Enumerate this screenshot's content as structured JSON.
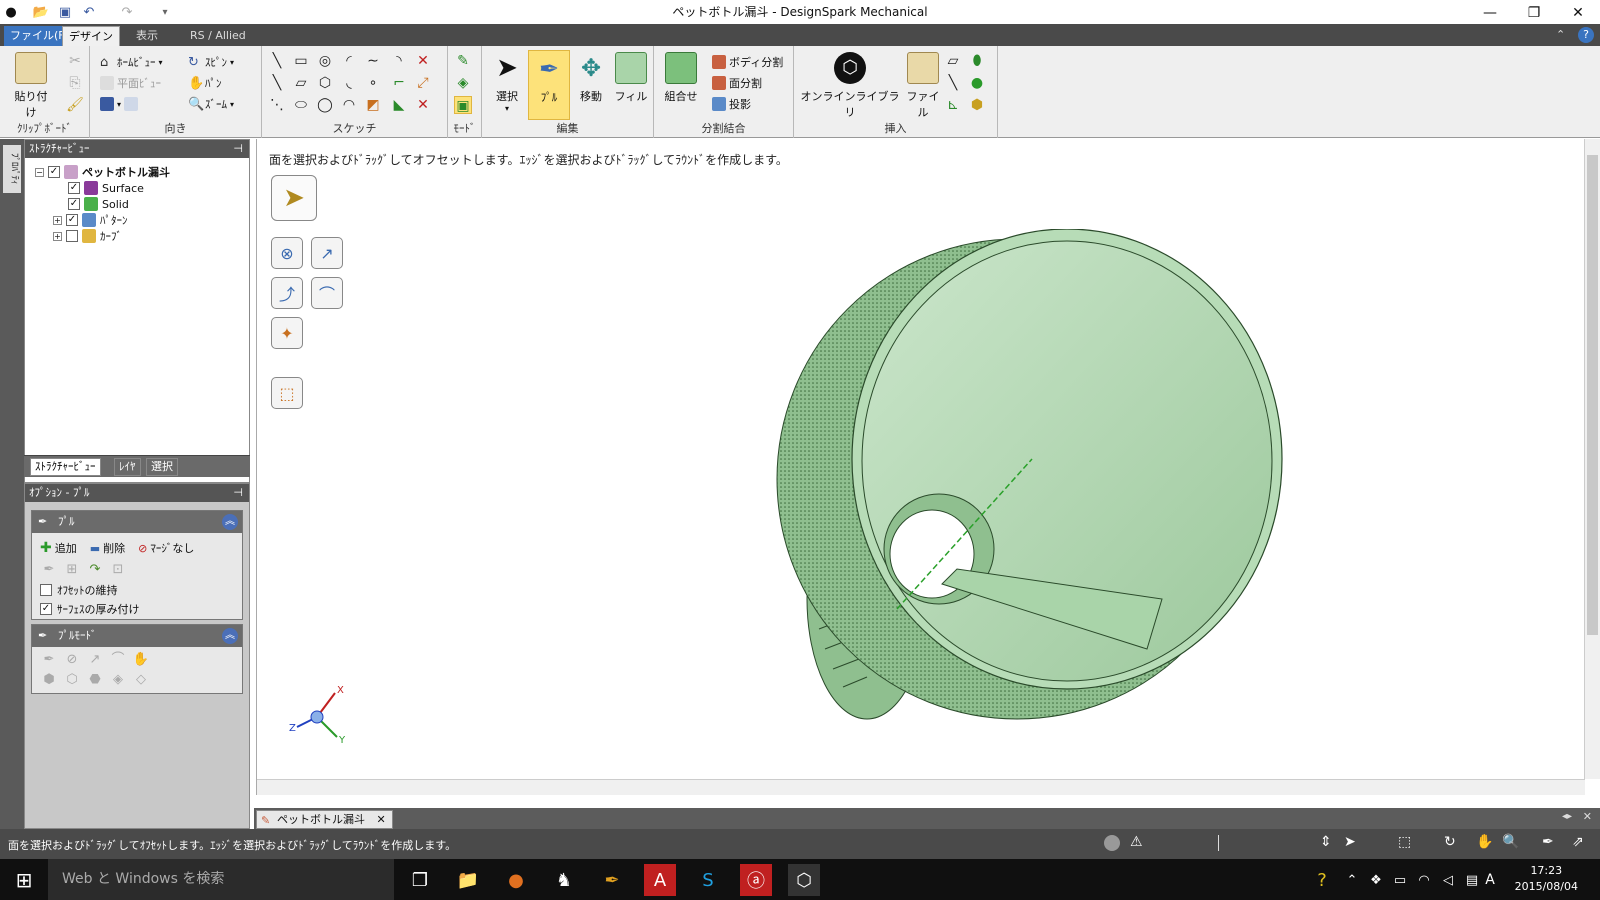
{
  "app": {
    "title": "ペットボトル漏斗 - DesignSpark Mechanical"
  },
  "window_controls": {
    "minimize": "—",
    "maximize": "❐",
    "close": "✕"
  },
  "tabs": [
    {
      "label": "ファイル(F)"
    },
    {
      "label": "デザイン"
    },
    {
      "label": "表示"
    },
    {
      "label": "RS / Allied"
    }
  ],
  "ribbon": {
    "clipboard": {
      "group_label": "ｸﾘｯﾌﾟﾎﾞｰﾄﾞ",
      "paste_label": "貼り付け"
    },
    "orient": {
      "group_label": "向き",
      "home_view": "ﾎｰﾑﾋﾞｭｰ",
      "plane_view": "平面ﾋﾞｭｰ",
      "spin": "ｽﾋﾟﾝ",
      "pan": "ﾊﾟﾝ",
      "zoom": "ｽﾞｰﾑ"
    },
    "sketch": {
      "group_label": "スケッチ"
    },
    "mode": {
      "group_label": "ﾓｰﾄﾞ"
    },
    "edit": {
      "group_label": "編集",
      "select": "選択",
      "pull": "ﾌﾟﾙ",
      "move": "移動",
      "fill": "フィル"
    },
    "intersect": {
      "group_label": "分割結合",
      "combine": "組合せ",
      "split_body": "ボディ分割",
      "split_face": "面分割",
      "project": "投影"
    },
    "insert": {
      "group_label": "挿入",
      "online_library": "オンラインライブラリ",
      "file": "ファイル"
    }
  },
  "left_strip": {
    "properties_tab": "ﾌﾟﾛﾊﾟﾃｨ"
  },
  "structure_panel": {
    "title": "ｽﾄﾗｸﾁｬｰﾋﾞｭｰ",
    "pin": "⊣",
    "root": {
      "label": "ペットボトル漏斗",
      "checked": true
    },
    "children": [
      {
        "label": "Surface",
        "checked": true
      },
      {
        "label": "Solid",
        "checked": true
      },
      {
        "label": "ﾊﾟﾀｰﾝ",
        "checked": true
      },
      {
        "label": "ｶｰﾌﾞ",
        "checked": false
      }
    ]
  },
  "panel_tabs": [
    {
      "label": "ｽﾄﾗｸﾁｬｰﾋﾞｭｰ"
    },
    {
      "label": "ﾚｲﾔ"
    },
    {
      "label": "選択"
    }
  ],
  "options_panel": {
    "title": "ｵﾌﾟｼｮﾝ - ﾌﾟﾙ",
    "pull_box": {
      "title": "ﾌﾟﾙ",
      "add": "追加",
      "remove": "削除",
      "no_merge": "ﾏｰｼﾞなし",
      "keep_offset": "ｵﾌｾｯﾄの維持",
      "keep_offset_checked": false,
      "thicken_surfaces": "ｻｰﾌｪｽの厚み付け",
      "thicken_surfaces_checked": true
    },
    "pull_mode_box": {
      "title": "ﾌﾟﾙﾓｰﾄﾞ"
    }
  },
  "canvas": {
    "hint": "面を選択およびﾄﾞﾗｯｸﾞしてオフセットします。ｴｯｼﾞを選択およびﾄﾞﾗｯｸﾞしてﾗｳﾝﾄﾞを作成します。",
    "model_color": "#a9d4a9",
    "axis_labels": {
      "x": "X",
      "y": "Y",
      "z": "Z"
    }
  },
  "document_tab": {
    "label": "ペットボトル漏斗"
  },
  "status_bar": {
    "message": "面を選択およびﾄﾞﾗｯｸﾞしてｵﾌｾｯﾄします。ｴｯｼﾞを選択およびﾄﾞﾗｯｸﾞしてﾗｳﾝﾄﾞを作成します。"
  },
  "taskbar": {
    "search_placeholder": "Web と Windows を検索",
    "time": "17:23",
    "date": "2015/08/04",
    "ime": "A"
  }
}
